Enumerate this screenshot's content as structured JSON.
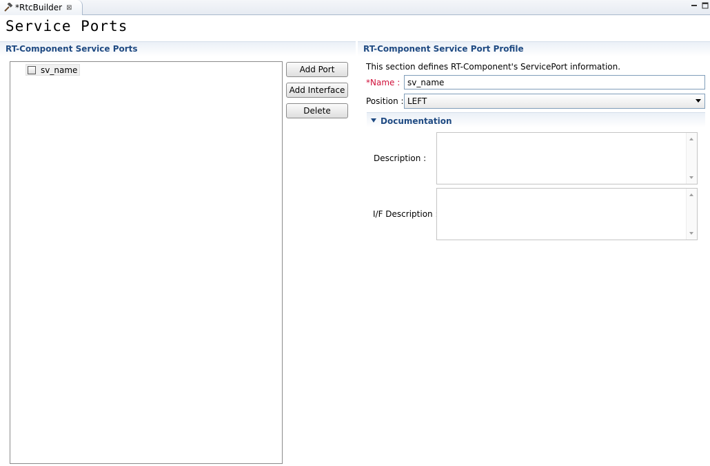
{
  "tab": {
    "label": "*RtcBuilder",
    "close": "⊠"
  },
  "page_title": "Service Ports",
  "left_section": {
    "title": "RT-Component Service Ports",
    "tree_items": [
      {
        "label": "sv_name",
        "checked": false
      }
    ],
    "buttons": {
      "add_port": "Add Port",
      "add_interface": "Add Interface",
      "delete": "Delete"
    }
  },
  "right_section": {
    "title": "RT-Component Service Port Profile",
    "info": "This section defines RT-Component's ServicePort information.",
    "name_label_required": "*Name",
    "name_label_colon": " :",
    "name_value": "sv_name",
    "position_label": "Position :",
    "position_value": "LEFT",
    "documentation": {
      "title": "Documentation",
      "description_label": "Description :",
      "description_value": "",
      "if_description_label": "I/F Description :",
      "if_description_value": ""
    }
  },
  "colors": {
    "section_title": "#1f4a82",
    "required": "#d0103a"
  }
}
